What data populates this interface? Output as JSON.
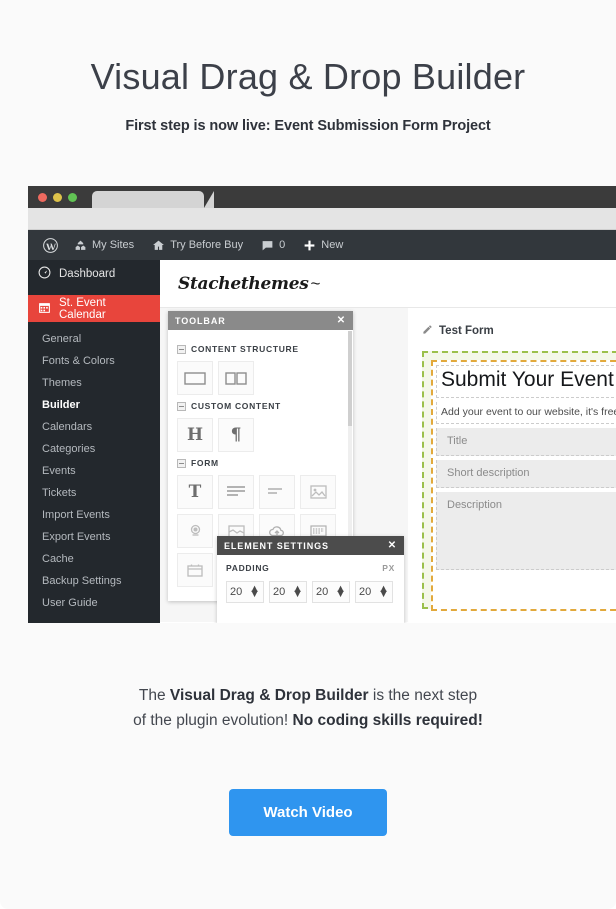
{
  "hero": {
    "title": "Visual Drag & Drop Builder",
    "subtitle": "First step is now live: Event Submission Form Project"
  },
  "browser": {
    "traffic_lights": [
      "close-red",
      "minimize-yellow",
      "maximize-green"
    ],
    "tab_label": ""
  },
  "adminbar": {
    "items": [
      {
        "icon": "wordpress-logo-icon",
        "label": ""
      },
      {
        "icon": "my-sites-icon",
        "label": "My Sites"
      },
      {
        "icon": "home-icon",
        "label": "Try Before Buy"
      },
      {
        "icon": "comment-icon",
        "label": "0"
      },
      {
        "icon": "plus-icon",
        "label": "New"
      }
    ]
  },
  "sidebar": {
    "dashboard": {
      "label": "Dashboard",
      "icon": "dashboard-icon"
    },
    "current": {
      "label": "St. Event Calendar",
      "icon": "calendar-icon"
    },
    "submenu": [
      {
        "label": "General",
        "active": false
      },
      {
        "label": "Fonts & Colors",
        "active": false
      },
      {
        "label": "Themes",
        "active": false
      },
      {
        "label": "Builder",
        "active": true
      },
      {
        "label": "Calendars",
        "active": false
      },
      {
        "label": "Categories",
        "active": false
      },
      {
        "label": "Events",
        "active": false
      },
      {
        "label": "Tickets",
        "active": false
      },
      {
        "label": "Import Events",
        "active": false
      },
      {
        "label": "Export Events",
        "active": false
      },
      {
        "label": "Cache",
        "active": false
      },
      {
        "label": "Backup Settings",
        "active": false
      },
      {
        "label": "User Guide",
        "active": false
      }
    ]
  },
  "brand": {
    "logo_text": "Stachethemes"
  },
  "toolbar_panel": {
    "title": "TOOLBAR",
    "close_label": "✕",
    "sections": [
      {
        "title": "CONTENT STRUCTURE",
        "tiles": [
          {
            "name": "one-column-icon",
            "glyph": ""
          },
          {
            "name": "two-column-icon",
            "glyph": ""
          }
        ]
      },
      {
        "title": "CUSTOM CONTENT",
        "tiles": [
          {
            "name": "heading-icon",
            "glyph": "H"
          },
          {
            "name": "paragraph-icon",
            "glyph": "¶"
          }
        ]
      },
      {
        "title": "FORM",
        "tiles": [
          {
            "name": "text-input-icon",
            "glyph": "T"
          },
          {
            "name": "textarea-icon",
            "glyph": ""
          },
          {
            "name": "short-text-icon",
            "glyph": ""
          },
          {
            "name": "image-upload-icon",
            "glyph": ""
          },
          {
            "name": "location-pin-icon",
            "glyph": ""
          },
          {
            "name": "map-icon",
            "glyph": ""
          },
          {
            "name": "upload-cloud-icon",
            "glyph": ""
          },
          {
            "name": "ticket-icon",
            "glyph": ""
          },
          {
            "name": "date-icon",
            "glyph": ""
          },
          {
            "name": "captcha-icon",
            "glyph": ""
          }
        ]
      }
    ]
  },
  "settings_panel": {
    "title": "ELEMENT SETTINGS",
    "close_label": "✕",
    "padding_label": "PADDING",
    "unit_label": "PX",
    "padding_values": [
      "20",
      "20",
      "20",
      "20"
    ]
  },
  "form_preview": {
    "edit_icon": "pencil-icon",
    "title": "Test Form",
    "heading": "Submit Your Event",
    "intro": "Add your event to our website, it's free!",
    "fields": [
      {
        "label": "Title",
        "type": "input"
      },
      {
        "label": "Short description",
        "type": "input"
      },
      {
        "label": "Description",
        "type": "textarea"
      }
    ]
  },
  "footer": {
    "line1_prefix": "The ",
    "line1_bold": "Visual Drag & Drop Builder",
    "line1_suffix": " is the next step",
    "line2_prefix": "of the plugin evolution! ",
    "line2_bold": "No coding skills required!",
    "cta_label": "Watch Video"
  },
  "colors": {
    "accent_blue": "#2f95ef",
    "wp_red": "#e8453c",
    "wp_dark": "#23282d",
    "canvas_green": "#9bc04a",
    "canvas_orange": "#e2a93c"
  }
}
